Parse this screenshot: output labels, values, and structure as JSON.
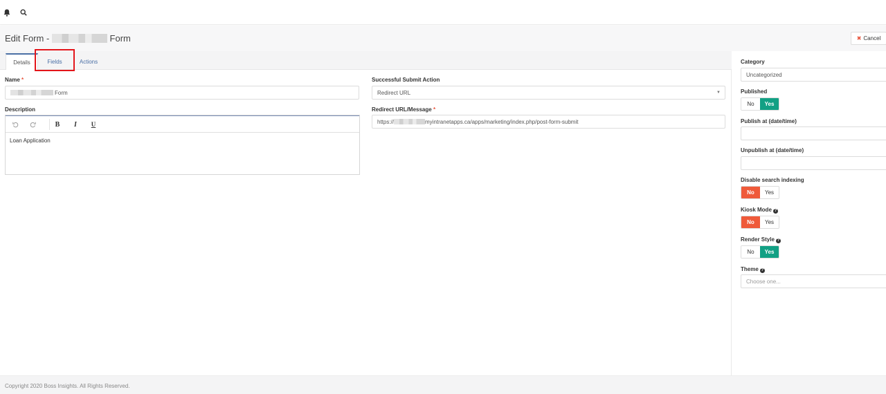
{
  "topbar": {
    "bell_icon": "bell-icon",
    "search_icon": "search-icon"
  },
  "header": {
    "title_prefix": "Edit Form -",
    "title_suffix": "Form",
    "cancel_label": "Cancel"
  },
  "tabs": [
    {
      "label": "Details",
      "active": true
    },
    {
      "label": "Fields",
      "active": false
    },
    {
      "label": "Actions",
      "active": false
    }
  ],
  "form": {
    "name_label": "Name",
    "name_value_suffix": "Form",
    "description_label": "Description",
    "description_value": "Loan Application",
    "submit_action_label": "Successful Submit Action",
    "submit_action_value": "Redirect URL",
    "redirect_label": "Redirect URL/Message",
    "redirect_prefix": "https://",
    "redirect_suffix": "myintranetapps.ca/apps/marketing/index.php/post-form-submit"
  },
  "editor_toolbar": {
    "undo_icon": "undo-icon",
    "redo_icon": "redo-icon",
    "bold": "B",
    "italic": "I",
    "underline": "U"
  },
  "sidebar": {
    "category_label": "Category",
    "category_value": "Uncategorized",
    "published_label": "Published",
    "published_value": "Yes",
    "publish_at_label": "Publish at (date/time)",
    "publish_at_value": "",
    "unpublish_at_label": "Unpublish at (date/time)",
    "unpublish_at_value": "",
    "disable_search_label": "Disable search indexing",
    "disable_search_value": "No",
    "kiosk_label": "Kiosk Mode",
    "kiosk_value": "No",
    "render_label": "Render Style",
    "render_value": "Yes",
    "theme_label": "Theme",
    "theme_placeholder": "Choose one...",
    "toggle_no": "No",
    "toggle_yes": "Yes"
  },
  "footer": {
    "copyright": "Copyright 2020 Boss Insights. All Rights Reserved."
  },
  "colors": {
    "accent_blue": "#4a6fa5",
    "yes_green": "#12a084",
    "no_red": "#ef5a3a",
    "required_star": "#e8533b",
    "highlight": "#e3151a"
  }
}
